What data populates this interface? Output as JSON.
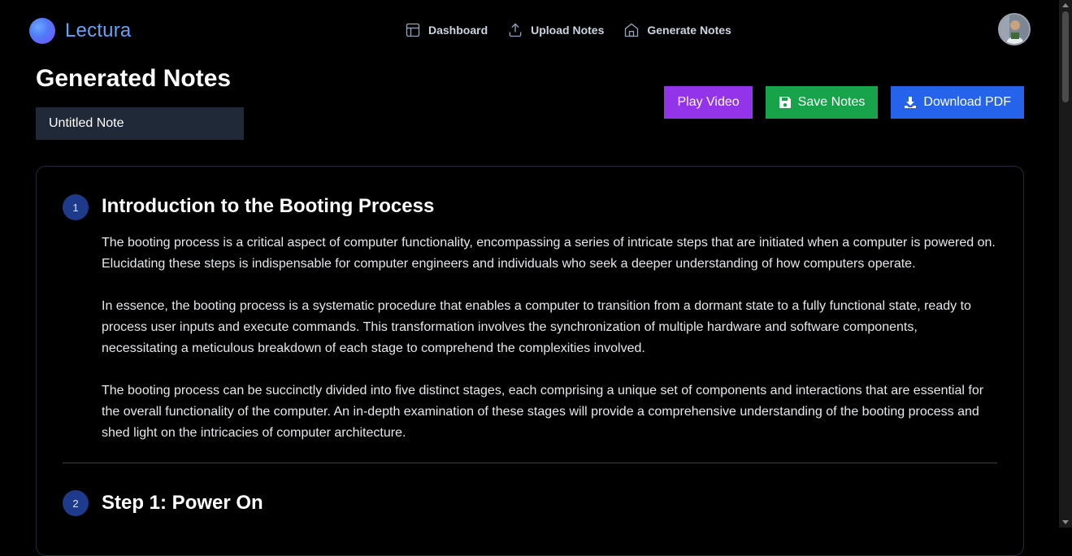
{
  "brand": {
    "name": "Lectura"
  },
  "nav": [
    {
      "label": "Dashboard",
      "icon": "layout-icon"
    },
    {
      "label": "Upload Notes",
      "icon": "upload-icon"
    },
    {
      "label": "Generate Notes",
      "icon": "home-icon"
    }
  ],
  "page": {
    "title": "Generated Notes",
    "note_title_value": "Untitled Note"
  },
  "actions": {
    "play": "Play Video",
    "save": "Save Notes",
    "download": "Download PDF"
  },
  "sections": [
    {
      "number": "1",
      "title": "Introduction to the Booting Process",
      "paragraphs": [
        "The booting process is a critical aspect of computer functionality, encompassing a series of intricate steps that are initiated when a computer is powered on. Elucidating these steps is indispensable for computer engineers and individuals who seek a deeper understanding of how computers operate.",
        "In essence, the booting process is a systematic procedure that enables a computer to transition from a dormant state to a fully functional state, ready to process user inputs and execute commands. This transformation involves the synchronization of multiple hardware and software components, necessitating a meticulous breakdown of each stage to comprehend the complexities involved.",
        "The booting process can be succinctly divided into five distinct stages, each comprising a unique set of components and interactions that are essential for the overall functionality of the computer. An in-depth examination of these stages will provide a comprehensive understanding of the booting process and shed light on the intricacies of computer architecture."
      ]
    },
    {
      "number": "2",
      "title": "Step 1: Power On"
    }
  ],
  "colors": {
    "background": "#000000",
    "brand": "#60a5fa",
    "play": "#9333ea",
    "save": "#16a34a",
    "download": "#2563eb",
    "badge": "#1e3a8a"
  }
}
